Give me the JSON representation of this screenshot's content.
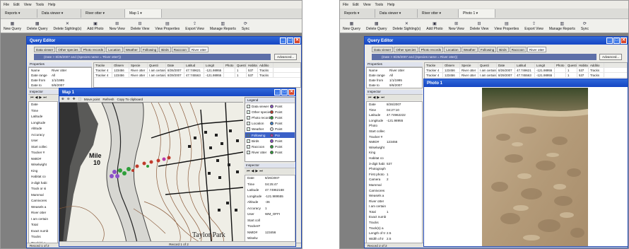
{
  "menu": [
    "File",
    "Edit",
    "View",
    "Tools",
    "Help"
  ],
  "left": {
    "tabs": [
      {
        "label": "Reports ▾"
      },
      {
        "label": "Data viewer ▾"
      },
      {
        "label": "River otter ▾"
      },
      {
        "label": "Map 1 ▾",
        "active": true
      }
    ],
    "toolbar": [
      {
        "label": "New Query",
        "icon": "new-query-icon",
        "glyph": "▦"
      },
      {
        "label": "Delete Query",
        "icon": "delete-query-icon",
        "glyph": "▦"
      },
      {
        "label": "Delete Sighting(s)",
        "icon": "delete-sighting-icon",
        "glyph": "✕"
      },
      {
        "label": "Add Photo",
        "icon": "add-photo-icon",
        "glyph": "▣"
      },
      {
        "label": "New View",
        "icon": "new-view-icon",
        "glyph": "⊞"
      },
      {
        "label": "Delete View",
        "icon": "delete-view-icon",
        "glyph": "⊟"
      },
      {
        "label": "View Properties",
        "icon": "view-properties-icon",
        "glyph": "▤"
      },
      {
        "label": "Export View",
        "icon": "export-view-icon",
        "glyph": "⇪"
      },
      {
        "label": "Manage Reports",
        "icon": "manage-reports-icon",
        "glyph": "▥"
      },
      {
        "label": "Sync",
        "icon": "sync-icon",
        "glyph": "⟳"
      }
    ],
    "query_editor": {
      "title": "Query Editor",
      "subtabs": [
        "Data viewer",
        "Other species",
        "Photo records",
        "Location",
        "Weather",
        "Following",
        "Birds",
        "Raccoon",
        "River otter"
      ],
      "query_text": "(Date > 8/25/2007 and (Species name = 'River otter'))",
      "advanced_label": "Advanced...",
      "properties_label": "Properties",
      "properties": [
        {
          "k": "Name",
          "v": "River otter"
        },
        {
          "k": "Date range",
          "v": "All"
        },
        {
          "k": "Date from",
          "v": "1/1/1995"
        },
        {
          "k": "Date to",
          "v": "9/6/2007"
        }
      ],
      "grid_headers": [
        "Tracke",
        "Observ",
        "Specie",
        "Questi",
        "Date",
        "Latitud",
        "Longit",
        "Photo",
        "Questi",
        "Habita",
        "Additio"
      ],
      "grid_rows": [
        [
          "Tracker 4",
          "123456",
          "River otter",
          "I am certain",
          "8/26/2007",
          "47.749621",
          "-121.98955",
          "",
          "1",
          "537",
          "Tracks"
        ],
        [
          "Tracker 4",
          "123456",
          "River otter",
          "I am certain",
          "8/29/2007",
          "47.745563",
          "-121.98955",
          "",
          "1",
          "537",
          "Tracks"
        ]
      ],
      "inspector_label": "Inspector",
      "inspector_fields": [
        "Date",
        "Time",
        "Latitude",
        "Longitude",
        "Altitude",
        "Accuracy",
        "User",
        "Start collec",
        "Tracker #",
        "NMID#",
        "Wiselwight",
        "King",
        "Habitat co",
        "3-digit habi",
        "Track or si",
        "Mammal",
        "Carnivores",
        "Weasels a",
        "River otter",
        "I am certain",
        "Total",
        "Exact numb",
        "Tracks",
        "Track(s) a"
      ],
      "status": "Record 1 of 2"
    },
    "map": {
      "title": "Map 1",
      "toolbar": [
        "Move point",
        "Refresh",
        "Copy To clipboard"
      ],
      "labels": [
        "Mile",
        "10",
        "Taylor Park"
      ],
      "legend_title": "Legend",
      "legend": [
        {
          "name": "Data viewer",
          "shape": "Point",
          "color": "#8b4fc8"
        },
        {
          "name": "Other specie",
          "shape": "Point",
          "color": "#c03a2b"
        },
        {
          "name": "Photo record",
          "shape": "Point",
          "color": "#2e9e3a"
        },
        {
          "name": "Location",
          "shape": "Point",
          "color": "#3a7dc8"
        },
        {
          "name": "Weather",
          "shape": "Point",
          "color": "#e8e8e8"
        },
        {
          "name": "Following",
          "shape": "Poi",
          "color": "#b83aa8",
          "selected": true
        },
        {
          "name": "Birds",
          "shape": "Point",
          "color": "#8b4fc8"
        },
        {
          "name": "Raccoon",
          "shape": "Point",
          "color": "#2e9e3a"
        },
        {
          "name": "River otter",
          "shape": "Point",
          "color": "#2e9e3a"
        }
      ],
      "inspector_label": "Inspector",
      "inspector": [
        {
          "k": "Date",
          "v": "8/26/2007"
        },
        {
          "k": "Time",
          "v": "04:25:47"
        },
        {
          "k": "Latitude",
          "v": "47.74962168"
        },
        {
          "k": "Longitude",
          "v": "-121.989555"
        },
        {
          "k": "Altitude",
          "v": "-36"
        },
        {
          "k": "Accuracy",
          "v": "1"
        },
        {
          "k": "User",
          "v": "WM_OFFI"
        },
        {
          "k": "Start coll",
          "v": ""
        },
        {
          "k": "Tracker#",
          "v": ""
        },
        {
          "k": "NMID#",
          "v": "123456"
        },
        {
          "k": "Wiselw",
          "v": ""
        }
      ],
      "status": "Record 1 of 2"
    }
  },
  "right": {
    "tabs": [
      {
        "label": "Reports ▾"
      },
      {
        "label": "Data viewer ▾"
      },
      {
        "label": "River otter ▾"
      },
      {
        "label": "Photo 1 ▾",
        "active": true
      }
    ],
    "query_editor": {
      "title": "Query Editor",
      "subtabs": [
        "Data viewer",
        "Other species",
        "Photo records",
        "Location",
        "Weather",
        "Following",
        "Birds",
        "Raccoon",
        "River otter"
      ],
      "query_text": "(Date > 8/25/2007 and (Species name = River otter))",
      "advanced_label": "Advanced...",
      "properties_label": "Properties",
      "properties": [
        {
          "k": "Name",
          "v": "River otter"
        },
        {
          "k": "Date range",
          "v": "All"
        },
        {
          "k": "Date from",
          "v": "1/1/1995"
        },
        {
          "k": "Date to",
          "v": "9/6/2007"
        }
      ],
      "grid_headers": [
        "Tracke",
        "Observ",
        "Specie",
        "Questi",
        "Date",
        "Latitud",
        "Longit",
        "Photo",
        "Questi",
        "Habita",
        "Additio"
      ],
      "grid_rows": [
        [
          "Tracker 4",
          "123456",
          "River otter",
          "I am certain",
          "8/26/2007",
          "47.749621",
          "-121.98955",
          "",
          "1",
          "537",
          "Tracks"
        ],
        [
          "Tracker 4",
          "123456",
          "River otter",
          "I am certain",
          "8/29/2007",
          "47.745563",
          "-121.98955",
          "",
          "1",
          "537",
          "Tracks"
        ]
      ],
      "inspector_label": "Inspector",
      "inspector": [
        {
          "k": "Date",
          "v": "8/26/2007"
        },
        {
          "k": "Time",
          "v": "04:27:10"
        },
        {
          "k": "Latitude",
          "v": "47.74962222"
        },
        {
          "k": "Longitude",
          "v": "-121.98955"
        },
        {
          "k": "Photo",
          "v": ""
        },
        {
          "k": "Start collec",
          "v": ""
        },
        {
          "k": "Tracker #",
          "v": ""
        },
        {
          "k": "NMID#",
          "v": "123456"
        },
        {
          "k": "Wiselwight",
          "v": ""
        },
        {
          "k": "King",
          "v": ""
        },
        {
          "k": "Habitat co",
          "v": ""
        },
        {
          "k": "3-digit habi",
          "v": "537"
        },
        {
          "k": "Photograph",
          "v": ""
        },
        {
          "k": "First photo",
          "v": "1"
        },
        {
          "k": "Camera",
          "v": "2"
        },
        {
          "k": "Mammal",
          "v": ""
        },
        {
          "k": "Carnivores",
          "v": ""
        },
        {
          "k": "Weasels a",
          "v": ""
        },
        {
          "k": "River otter",
          "v": ""
        },
        {
          "k": "I am certain",
          "v": ""
        },
        {
          "k": "Total",
          "v": "1"
        },
        {
          "k": "Exact numb",
          "v": ""
        },
        {
          "k": "Tracks",
          "v": ""
        },
        {
          "k": "Track(s) a",
          "v": ""
        },
        {
          "k": "Length of tr",
          "v": "2.5"
        },
        {
          "k": "Width of tr",
          "v": "2.5"
        }
      ],
      "status": "Record 2 of 2"
    },
    "photo": {
      "title": "Photo 1"
    }
  }
}
